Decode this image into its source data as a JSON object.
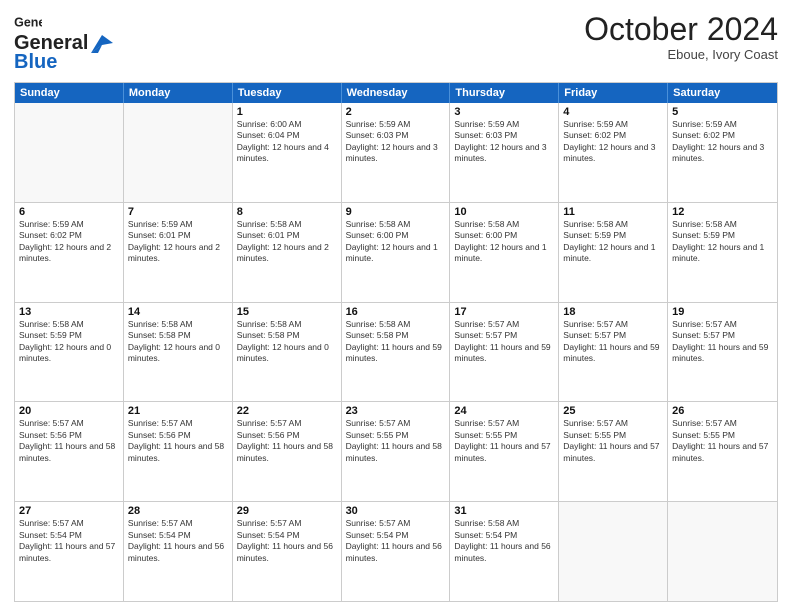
{
  "logo": {
    "general": "General",
    "blue": "Blue"
  },
  "title": "October 2024",
  "subtitle": "Eboue, Ivory Coast",
  "days": [
    "Sunday",
    "Monday",
    "Tuesday",
    "Wednesday",
    "Thursday",
    "Friday",
    "Saturday"
  ],
  "weeks": [
    [
      {
        "day": "",
        "text": ""
      },
      {
        "day": "",
        "text": ""
      },
      {
        "day": "1",
        "text": "Sunrise: 6:00 AM\nSunset: 6:04 PM\nDaylight: 12 hours and 4 minutes."
      },
      {
        "day": "2",
        "text": "Sunrise: 5:59 AM\nSunset: 6:03 PM\nDaylight: 12 hours and 3 minutes."
      },
      {
        "day": "3",
        "text": "Sunrise: 5:59 AM\nSunset: 6:03 PM\nDaylight: 12 hours and 3 minutes."
      },
      {
        "day": "4",
        "text": "Sunrise: 5:59 AM\nSunset: 6:02 PM\nDaylight: 12 hours and 3 minutes."
      },
      {
        "day": "5",
        "text": "Sunrise: 5:59 AM\nSunset: 6:02 PM\nDaylight: 12 hours and 3 minutes."
      }
    ],
    [
      {
        "day": "6",
        "text": "Sunrise: 5:59 AM\nSunset: 6:02 PM\nDaylight: 12 hours and 2 minutes."
      },
      {
        "day": "7",
        "text": "Sunrise: 5:59 AM\nSunset: 6:01 PM\nDaylight: 12 hours and 2 minutes."
      },
      {
        "day": "8",
        "text": "Sunrise: 5:58 AM\nSunset: 6:01 PM\nDaylight: 12 hours and 2 minutes."
      },
      {
        "day": "9",
        "text": "Sunrise: 5:58 AM\nSunset: 6:00 PM\nDaylight: 12 hours and 1 minute."
      },
      {
        "day": "10",
        "text": "Sunrise: 5:58 AM\nSunset: 6:00 PM\nDaylight: 12 hours and 1 minute."
      },
      {
        "day": "11",
        "text": "Sunrise: 5:58 AM\nSunset: 5:59 PM\nDaylight: 12 hours and 1 minute."
      },
      {
        "day": "12",
        "text": "Sunrise: 5:58 AM\nSunset: 5:59 PM\nDaylight: 12 hours and 1 minute."
      }
    ],
    [
      {
        "day": "13",
        "text": "Sunrise: 5:58 AM\nSunset: 5:59 PM\nDaylight: 12 hours and 0 minutes."
      },
      {
        "day": "14",
        "text": "Sunrise: 5:58 AM\nSunset: 5:58 PM\nDaylight: 12 hours and 0 minutes."
      },
      {
        "day": "15",
        "text": "Sunrise: 5:58 AM\nSunset: 5:58 PM\nDaylight: 12 hours and 0 minutes."
      },
      {
        "day": "16",
        "text": "Sunrise: 5:58 AM\nSunset: 5:58 PM\nDaylight: 11 hours and 59 minutes."
      },
      {
        "day": "17",
        "text": "Sunrise: 5:57 AM\nSunset: 5:57 PM\nDaylight: 11 hours and 59 minutes."
      },
      {
        "day": "18",
        "text": "Sunrise: 5:57 AM\nSunset: 5:57 PM\nDaylight: 11 hours and 59 minutes."
      },
      {
        "day": "19",
        "text": "Sunrise: 5:57 AM\nSunset: 5:57 PM\nDaylight: 11 hours and 59 minutes."
      }
    ],
    [
      {
        "day": "20",
        "text": "Sunrise: 5:57 AM\nSunset: 5:56 PM\nDaylight: 11 hours and 58 minutes."
      },
      {
        "day": "21",
        "text": "Sunrise: 5:57 AM\nSunset: 5:56 PM\nDaylight: 11 hours and 58 minutes."
      },
      {
        "day": "22",
        "text": "Sunrise: 5:57 AM\nSunset: 5:56 PM\nDaylight: 11 hours and 58 minutes."
      },
      {
        "day": "23",
        "text": "Sunrise: 5:57 AM\nSunset: 5:55 PM\nDaylight: 11 hours and 58 minutes."
      },
      {
        "day": "24",
        "text": "Sunrise: 5:57 AM\nSunset: 5:55 PM\nDaylight: 11 hours and 57 minutes."
      },
      {
        "day": "25",
        "text": "Sunrise: 5:57 AM\nSunset: 5:55 PM\nDaylight: 11 hours and 57 minutes."
      },
      {
        "day": "26",
        "text": "Sunrise: 5:57 AM\nSunset: 5:55 PM\nDaylight: 11 hours and 57 minutes."
      }
    ],
    [
      {
        "day": "27",
        "text": "Sunrise: 5:57 AM\nSunset: 5:54 PM\nDaylight: 11 hours and 57 minutes."
      },
      {
        "day": "28",
        "text": "Sunrise: 5:57 AM\nSunset: 5:54 PM\nDaylight: 11 hours and 56 minutes."
      },
      {
        "day": "29",
        "text": "Sunrise: 5:57 AM\nSunset: 5:54 PM\nDaylight: 11 hours and 56 minutes."
      },
      {
        "day": "30",
        "text": "Sunrise: 5:57 AM\nSunset: 5:54 PM\nDaylight: 11 hours and 56 minutes."
      },
      {
        "day": "31",
        "text": "Sunrise: 5:58 AM\nSunset: 5:54 PM\nDaylight: 11 hours and 56 minutes."
      },
      {
        "day": "",
        "text": ""
      },
      {
        "day": "",
        "text": ""
      }
    ]
  ]
}
